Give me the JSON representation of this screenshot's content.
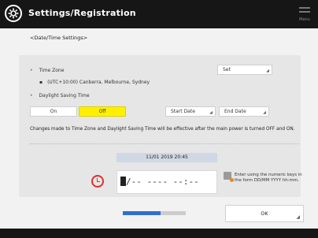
{
  "header": {
    "title": "Settings/Registration",
    "menu_sub": "Menu"
  },
  "breadcrumb": "<Date/Time Settings>",
  "timezone": {
    "label": "Time Zone",
    "value": "(UTC+10:00) Canberra, Melbourne, Sydney",
    "set_label": "Set"
  },
  "dst": {
    "label": "Daylight Saving Time",
    "on_label": "On",
    "off_label": "Off",
    "selected": "Off",
    "start_label": "Start Date",
    "end_label": "End Date"
  },
  "note": "Changes made to Time Zone and Daylight Saving Time will be effective after the main power is turned OFF and ON.",
  "datetime": {
    "display": "11/01 2019 20:45",
    "input_value": "/-- ---- --:--"
  },
  "hint": "Enter using the numeric keys in the form DD/MM YYYY hh:mm.",
  "progress": {
    "fraction": 0.6
  },
  "ok_label": "OK",
  "icons": {
    "header": "settings-gear-icon",
    "clock": "clock-icon",
    "keypad": "numeric-keypad-icon"
  },
  "colors": {
    "titlebar": "#161616",
    "active_toggle": "#fff000",
    "accent": "#2f6fd0",
    "clock": "#e03030"
  }
}
